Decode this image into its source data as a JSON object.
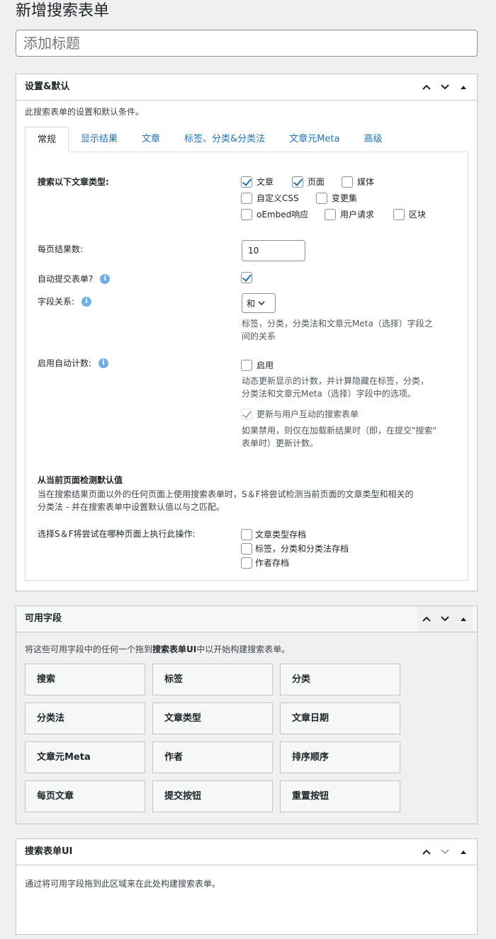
{
  "page": {
    "title": "新增搜索表单",
    "title_placeholder": "添加标题"
  },
  "settings_box": {
    "title": "设置&默认",
    "description": "此搜索表单的设置和默认条件。",
    "tabs": [
      {
        "label": "常规",
        "active": true
      },
      {
        "label": "显示结果",
        "active": false
      },
      {
        "label": "文章",
        "active": false
      },
      {
        "label": "标签、分类&分类法",
        "active": false
      },
      {
        "label": "文章元Meta",
        "active": false
      },
      {
        "label": "高级",
        "active": false
      }
    ],
    "post_types": {
      "label": "搜索以下文章类型:",
      "options": [
        {
          "label": "文章",
          "checked": true
        },
        {
          "label": "页面",
          "checked": true
        },
        {
          "label": "媒体",
          "checked": false
        },
        {
          "label": "自定义CSS",
          "checked": false
        },
        {
          "label": "变更集",
          "checked": false
        },
        {
          "label": "oEmbed响应",
          "checked": false
        },
        {
          "label": "用户请求",
          "checked": false
        },
        {
          "label": "区块",
          "checked": false
        }
      ]
    },
    "results_per_page": {
      "label": "每页结果数:",
      "value": "10"
    },
    "auto_submit": {
      "label": "自动提交表单?",
      "checked": true
    },
    "field_relation": {
      "label": "字段关系:",
      "value": "和",
      "description": [
        "标签，分类，分类法和文章元Meta（选择）字段之",
        "间的关系"
      ]
    },
    "auto_count": {
      "label": "启用自动计数:",
      "enable_label": "启用",
      "enabled": false,
      "description": [
        "动态更新显示的计数，并计算隐藏在标签，分类，",
        "分类法和文章元Meta（选择）字段中的选项。"
      ],
      "interactive_label": "更新与用户互动的搜索表单",
      "interactive_checked": true,
      "interactive_description": [
        "如果禁用，则仅在加载新结果时（即，在提交\"搜索\"",
        "表单时）更新计数。"
      ]
    },
    "detect_defaults": {
      "heading": "从当前页面检测默认值",
      "description": [
        "当在搜索结果页面以外的任何页面上使用搜索表单时，S＆F将尝试检测当前页面的文章类型和相关的",
        "分类法 - 并在搜索表单中设置默认值以与之匹配。"
      ],
      "pages_label": "选择S＆F将尝试在哪种页面上执行此操作:",
      "pages": [
        {
          "label": "文章类型存档",
          "checked": false
        },
        {
          "label": "标签，分类和分类法存档",
          "checked": false
        },
        {
          "label": "作者存档",
          "checked": false
        }
      ]
    }
  },
  "available_fields": {
    "title": "可用字段",
    "intro_before": "将这些可用字段中的任何一个拖到",
    "intro_bold": "搜索表单UI",
    "intro_after": "中以开始构建搜索表单。",
    "items": [
      "搜索",
      "标签",
      "分类",
      "分类法",
      "文章类型",
      "文章日期",
      "文章元Meta",
      "作者",
      "排序顺序",
      "每页文章",
      "提交按钮",
      "重置按钮"
    ]
  },
  "form_ui": {
    "title": "搜索表单UI",
    "description": "通过将可用字段拖到此区域来在此处构建搜索表单。"
  }
}
